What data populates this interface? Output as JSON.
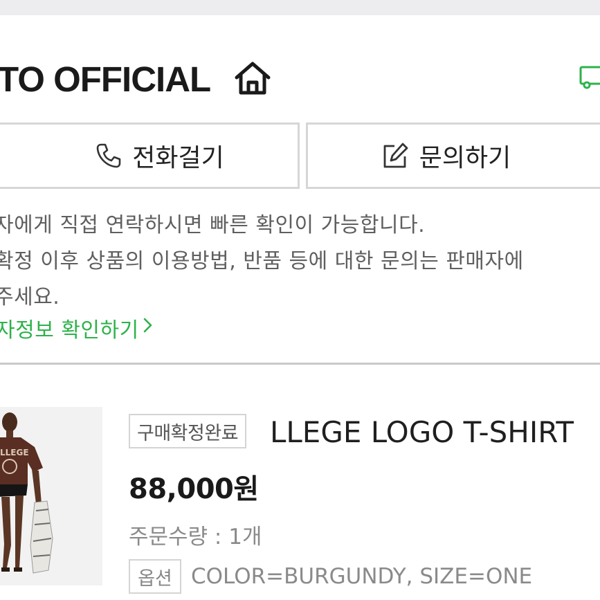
{
  "store": {
    "name": "TO OFFICIAL",
    "home_icon": "home-icon",
    "delivery_icon": "truck-icon"
  },
  "actions": {
    "call_label": "전화걸기",
    "call_icon": "phone-icon",
    "inquiry_label": "문의하기",
    "inquiry_icon": "edit-icon"
  },
  "notice": {
    "lines": [
      "자에게 직접 연락하시면 빠른 확인이 가능합니다.",
      "확정 이후 상품의 이용방법, 반품 등에 대한 문의는 판매자에",
      "주세요."
    ],
    "link_label": "자정보 확인하기",
    "link_color": "#2db24a"
  },
  "product": {
    "status": "구매확정완료",
    "name": "LLEGE LOGO T-SHIRT",
    "price": "88,000원",
    "quantity": "주문수량 : 1개",
    "option_label": "옵션",
    "option_value": "COLOR=BURGUNDY, SIZE=ONE",
    "shirt_text": "LLEGE",
    "image_colors": {
      "shirt": "#5a2e22",
      "background": "#f2f2f2"
    }
  }
}
